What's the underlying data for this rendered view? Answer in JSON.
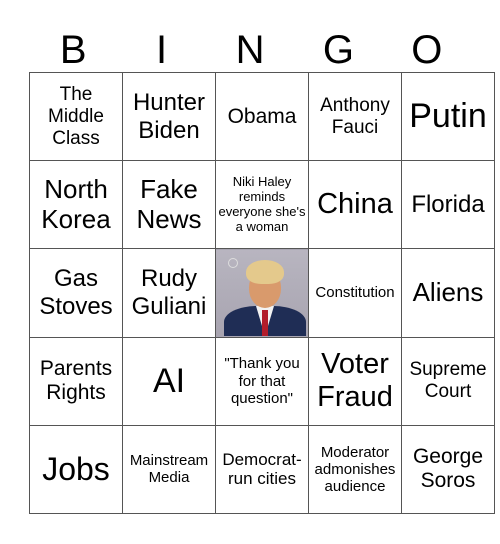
{
  "header": [
    "B",
    "I",
    "N",
    "G",
    "O"
  ],
  "rows": [
    [
      "The Middle Class",
      "Hunter Biden",
      "Obama",
      "Anthony Fauci",
      "Putin"
    ],
    [
      "North Korea",
      "Fake News",
      "Niki Haley reminds everyone she's a woman",
      "China",
      "Florida"
    ],
    [
      "Gas Stoves",
      "Rudy Guliani",
      "",
      "Constitution",
      "Aliens"
    ],
    [
      "Parents Rights",
      "AI",
      "\"Thank you for that question\"",
      "Voter Fraud",
      "Supreme Court"
    ],
    [
      "Jobs",
      "Mainstream Media",
      "Democrat-run cities",
      "Moderator admonishes audience",
      "George Soros"
    ]
  ],
  "free_space": {
    "image": "mugshot-photo"
  }
}
